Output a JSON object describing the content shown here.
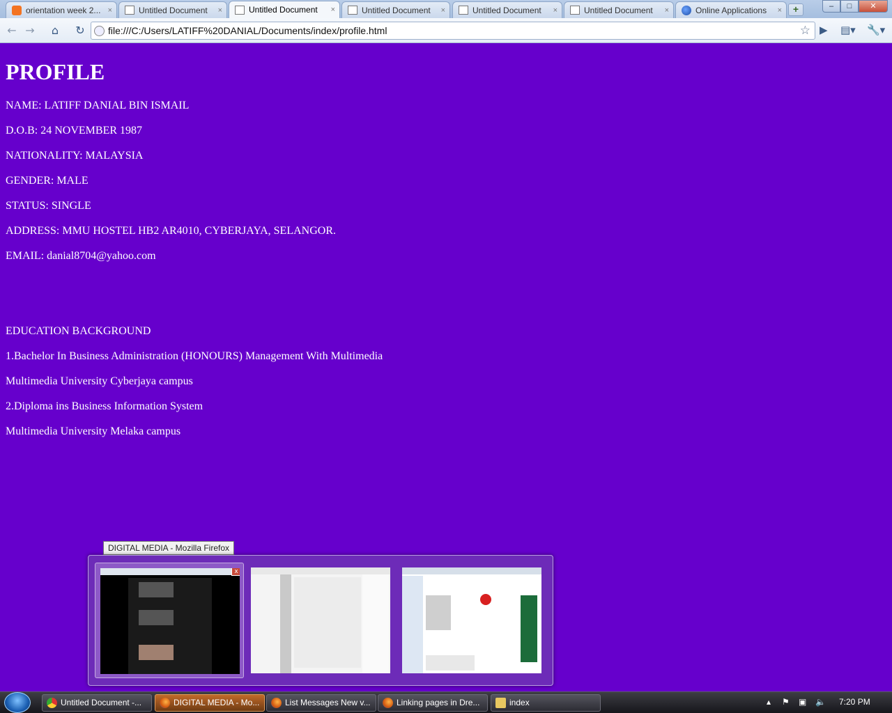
{
  "browser": {
    "tabs": [
      {
        "title": "orientation week 2...",
        "icon": "blogger-icon",
        "active": false
      },
      {
        "title": "Untitled Document",
        "icon": "document-icon",
        "active": false
      },
      {
        "title": "Untitled Document",
        "icon": "document-icon",
        "active": true
      },
      {
        "title": "Untitled Document",
        "icon": "document-icon",
        "active": false
      },
      {
        "title": "Untitled Document",
        "icon": "document-icon",
        "active": false
      },
      {
        "title": "Untitled Document",
        "icon": "document-icon",
        "active": false
      },
      {
        "title": "Online Applications",
        "icon": "globe-icon",
        "active": false
      }
    ],
    "tab_close_glyph": "×",
    "new_tab_glyph": "+",
    "window_buttons": {
      "minimize": "‒",
      "maximize": "□",
      "close": "✕"
    },
    "address": "file:///C:/Users/LATIFF%20DANIAL/Documents/index/profile.html"
  },
  "page": {
    "background": "#6600cc",
    "heading": "PROFILE",
    "details": [
      "NAME: LATIFF DANIAL BIN ISMAIL",
      "D.O.B: 24 NOVEMBER 1987",
      "NATIONALITY: MALAYSIA",
      "GENDER: MALE",
      "STATUS: SINGLE",
      "ADDRESS: MMU HOSTEL HB2 AR4010, CYBERJAYA, SELANGOR.",
      "EMAIL: danial8704@yahoo.com"
    ],
    "education_heading": "EDUCATION BACKGROUND",
    "education": [
      "1.Bachelor In Business Administration (HONOURS) Management With Multimedia",
      "Multimedia University Cyberjaya campus",
      "2.Diploma ins Business Information System",
      "Multimedia University Melaka campus"
    ]
  },
  "preview": {
    "tooltip": "DIGITAL MEDIA - Mozilla Firefox",
    "thumbnails": [
      "digital-media-window",
      "list-messages-window",
      "linking-pages-window"
    ],
    "close_glyph": "x"
  },
  "taskbar": {
    "items": [
      {
        "label": "Untitled Document -...",
        "icon": "chrome-icon",
        "active": false
      },
      {
        "label": "DIGITAL MEDIA - Mo...",
        "icon": "firefox-icon",
        "active": true
      },
      {
        "label": "List Messages New v...",
        "icon": "firefox-icon",
        "active": false
      },
      {
        "label": "Linking pages in Dre...",
        "icon": "firefox-icon",
        "active": false
      },
      {
        "label": "index",
        "icon": "folder-icon",
        "active": false
      }
    ],
    "clock": "7:20 PM"
  }
}
